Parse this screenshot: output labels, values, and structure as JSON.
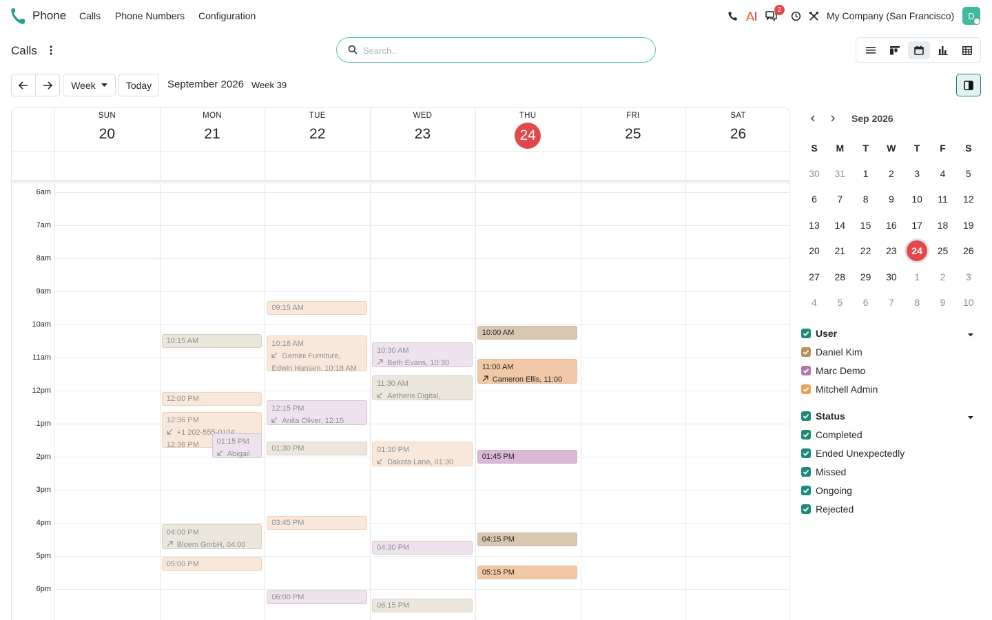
{
  "navbar": {
    "app_name": "Phone",
    "menu": [
      "Calls",
      "Phone Numbers",
      "Configuration"
    ],
    "notification_count": "2",
    "company": "My Company (San Francisco)",
    "avatar_initial": "D",
    "icons": [
      "phone-icon",
      "ai-icon",
      "messages-icon",
      "clock-icon",
      "tools-icon"
    ]
  },
  "control_panel": {
    "breadcrumb": "Calls",
    "search_placeholder": "Search...",
    "views": [
      "list-view-icon",
      "kanban-view-icon",
      "calendar-view-icon",
      "graph-view-icon",
      "pivot-view-icon"
    ],
    "active_view": "calendar"
  },
  "toolbar": {
    "scale": "Week",
    "today": "Today",
    "title": "September 2026",
    "week": "Week 39"
  },
  "calendar": {
    "days": [
      {
        "abbr": "SUN",
        "num": "20"
      },
      {
        "abbr": "MON",
        "num": "21"
      },
      {
        "abbr": "TUE",
        "num": "22"
      },
      {
        "abbr": "WED",
        "num": "23"
      },
      {
        "abbr": "THU",
        "num": "24"
      },
      {
        "abbr": "FRI",
        "num": "25"
      },
      {
        "abbr": "SAT",
        "num": "26"
      }
    ],
    "today_index": 4,
    "hours": [
      "6am",
      "7am",
      "8am",
      "9am",
      "10am",
      "11am",
      "12pm",
      "1pm",
      "2pm",
      "3pm",
      "4pm",
      "5pm",
      "6pm"
    ],
    "events": [
      {
        "day": 1,
        "time": "10:15 AM",
        "detail": "",
        "color": "beige",
        "status": "completed"
      },
      {
        "day": 1,
        "time": "12:00 PM",
        "detail": "",
        "color": "peach",
        "status": "completed"
      },
      {
        "day": 1,
        "time": "12:36 PM",
        "detail": "+1 202-555-0104",
        "detail2": "12:36 PM",
        "dir": "in",
        "color": "peach",
        "status": "completed"
      },
      {
        "day": 1,
        "time": "01:15 PM",
        "detail": "Abigail",
        "dir": "in",
        "color": "lilac",
        "status": "completed"
      },
      {
        "day": 1,
        "time": "04:00 PM",
        "detail": "Bloem GmbH, 04:00",
        "dir": "out",
        "color": "beige",
        "status": "completed"
      },
      {
        "day": 1,
        "time": "05:00 PM",
        "detail": "",
        "color": "peach",
        "status": "completed"
      },
      {
        "day": 2,
        "time": "09:15 AM",
        "detail": "",
        "color": "peach",
        "status": "completed"
      },
      {
        "day": 2,
        "time": "10:18 AM",
        "detail": "Gemini Furniture,",
        "detail2": "Edwin Hansen, 10:18 AM",
        "dir": "in",
        "color": "peach",
        "status": "completed"
      },
      {
        "day": 2,
        "time": "12:15 PM",
        "detail": "Anita Oliver, 12:15",
        "dir": "in",
        "color": "lilac",
        "status": "completed"
      },
      {
        "day": 2,
        "time": "01:30 PM",
        "detail": "",
        "color": "beige",
        "status": "completed"
      },
      {
        "day": 2,
        "time": "03:45 PM",
        "detail": "",
        "color": "peach",
        "status": "completed"
      },
      {
        "day": 2,
        "time": "06:00 PM",
        "detail": "",
        "color": "lilac",
        "status": "completed"
      },
      {
        "day": 3,
        "time": "10:30 AM",
        "detail": "Beth Evans, 10:30",
        "dir": "out",
        "color": "lilac",
        "status": "completed"
      },
      {
        "day": 3,
        "time": "11:30 AM",
        "detail": "Aetheris Digital,",
        "dir": "in",
        "color": "beige",
        "status": "completed"
      },
      {
        "day": 3,
        "time": "01:30 PM",
        "detail": "Dakota Lane, 01:30",
        "dir": "in",
        "color": "peach",
        "status": "completed"
      },
      {
        "day": 3,
        "time": "04:30 PM",
        "detail": "",
        "color": "lilac",
        "status": "completed"
      },
      {
        "day": 3,
        "time": "06:15 PM",
        "detail": "",
        "color": "beige",
        "status": "completed"
      },
      {
        "day": 4,
        "time": "10:00 AM",
        "detail": "",
        "color": "beige",
        "status": "upcoming"
      },
      {
        "day": 4,
        "time": "11:00 AM",
        "detail": "Cameron Ellis, 11:00",
        "dir": "out",
        "color": "peach",
        "status": "upcoming"
      },
      {
        "day": 4,
        "time": "01:45 PM",
        "detail": "",
        "color": "lilac",
        "status": "upcoming"
      },
      {
        "day": 4,
        "time": "04:15 PM",
        "detail": "",
        "color": "beige",
        "status": "upcoming"
      },
      {
        "day": 4,
        "time": "05:15 PM",
        "detail": "",
        "color": "peach",
        "status": "upcoming"
      }
    ]
  },
  "mini_calendar": {
    "title": "Sep 2026",
    "dow": [
      "S",
      "M",
      "T",
      "W",
      "T",
      "F",
      "S"
    ],
    "weeks": [
      [
        {
          "d": "30",
          "m": true
        },
        {
          "d": "31",
          "m": true
        },
        {
          "d": "1"
        },
        {
          "d": "2"
        },
        {
          "d": "3"
        },
        {
          "d": "4"
        },
        {
          "d": "5"
        }
      ],
      [
        {
          "d": "6"
        },
        {
          "d": "7"
        },
        {
          "d": "8"
        },
        {
          "d": "9"
        },
        {
          "d": "10"
        },
        {
          "d": "11"
        },
        {
          "d": "12"
        }
      ],
      [
        {
          "d": "13"
        },
        {
          "d": "14"
        },
        {
          "d": "15"
        },
        {
          "d": "16"
        },
        {
          "d": "17"
        },
        {
          "d": "18"
        },
        {
          "d": "19"
        }
      ],
      [
        {
          "d": "20"
        },
        {
          "d": "21"
        },
        {
          "d": "22"
        },
        {
          "d": "23"
        },
        {
          "d": "24",
          "t": true
        },
        {
          "d": "25"
        },
        {
          "d": "26"
        }
      ],
      [
        {
          "d": "27"
        },
        {
          "d": "28"
        },
        {
          "d": "29"
        },
        {
          "d": "30"
        },
        {
          "d": "1",
          "m": true
        },
        {
          "d": "2",
          "m": true
        },
        {
          "d": "3",
          "m": true
        }
      ],
      [
        {
          "d": "4",
          "m": true
        },
        {
          "d": "5",
          "m": true
        },
        {
          "d": "6",
          "m": true
        },
        {
          "d": "7",
          "m": true
        },
        {
          "d": "8",
          "m": true
        },
        {
          "d": "9",
          "m": true
        },
        {
          "d": "10",
          "m": true
        }
      ]
    ]
  },
  "filters": {
    "user_title": "User",
    "users": [
      {
        "name": "Daniel Kim",
        "color": "#b8925d"
      },
      {
        "name": "Marc Demo",
        "color": "#b07aa8"
      },
      {
        "name": "Mitchell Admin",
        "color": "#e6a15d"
      }
    ],
    "status_title": "Status",
    "statuses": [
      "Completed",
      "Ended Unexpectedly",
      "Missed",
      "Ongoing",
      "Rejected"
    ],
    "accent": "#1f8a7c"
  },
  "colors": {
    "primary": "#1f8a7c",
    "today": "#e3474c"
  }
}
